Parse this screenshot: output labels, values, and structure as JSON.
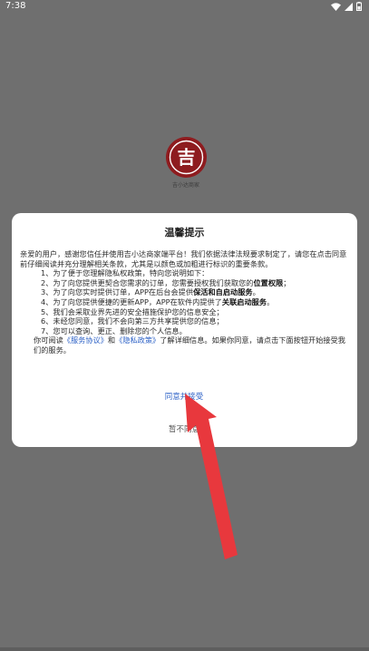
{
  "status_bar": {
    "time": "7:38",
    "icons": [
      "wifi-icon",
      "signal-icon",
      "battery-icon"
    ]
  },
  "app": {
    "logo_glyph": "吉",
    "logo_caption": "吉小达商家",
    "brand_color": "#8e1c1f"
  },
  "dialog": {
    "title": "温馨提示",
    "intro": "亲爱的用户，感谢您信任并使用吉小达商家端平台！我们依据法律法规要求制定了，请您在点击同意前仔细阅读并充分理解相关条款，尤其是以颜色或加粗进行标识的重要条款。",
    "lead": "1、为了便于您理解隐私权政策，特向您说明如下：",
    "item2_text": "2、为了向您提供更契合您需求的订单，您需要授权我们获取您的",
    "item2_bold": "位置权限",
    "item2_end": "；",
    "item3_text": "3、为了向您实时提供订单，APP在后台会提供",
    "item3_bold": "保活和自启动服务",
    "item3_end": "。",
    "item4_text": "4、为了向您提供便捷的更新APP，APP在软件内提供了",
    "item4_bold": "关联启动服务",
    "item4_end": "。",
    "item5": "5、我们会采取业界先进的安全措施保护您的信息安全；",
    "item6": "6、未经您同意，我们不会向第三方共享提供您的信息；",
    "item7": "7、您可以查询、更正、删除您的个人信息。",
    "read_prefix": "你可阅读",
    "service_agreement": "《服务协议》",
    "and": "和",
    "privacy_policy": "《隐私政策》",
    "read_suffix": "了解详细信息。如果你同意，请点击下面按钮开始接受我们的服务。",
    "agree_button": "同意并接受",
    "disagree_button": "暂不同意"
  },
  "colors": {
    "link": "#2f63c7",
    "annotation_arrow": "#e8383d"
  }
}
